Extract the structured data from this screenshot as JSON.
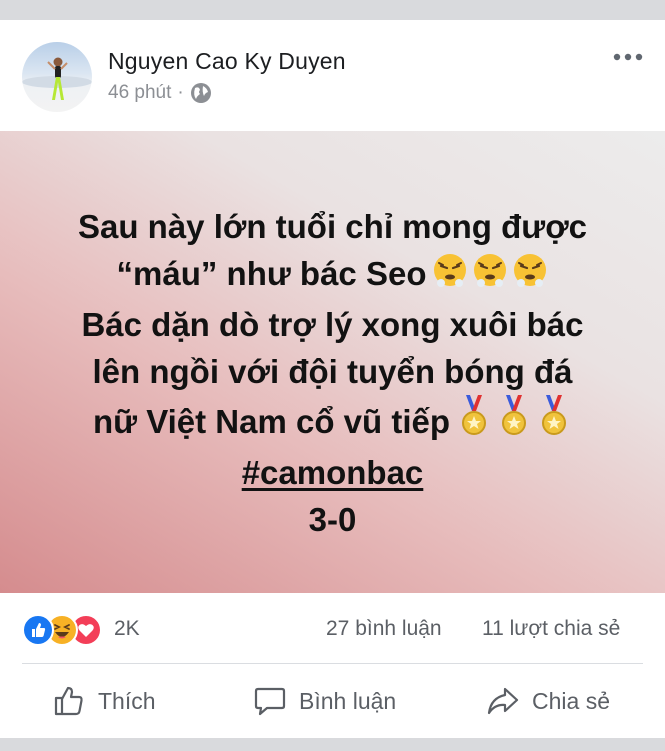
{
  "post": {
    "author": "Nguyen Cao Ky Duyen",
    "time": "46 phút",
    "separator": "·",
    "lines": [
      "Sau này lớn tuổi chỉ mong được",
      "“máu” như bác Seo",
      "Bác dặn dò trợ lý xong xuôi bác",
      "lên ngồi với đội tuyển bóng đá",
      "nữ Việt Nam cổ vũ tiếp",
      "#camonbac",
      "3-0"
    ],
    "emoji_line2": "huffing-face-emoji",
    "emoji_line5": "medal-emoji",
    "background_colors": [
      "#d58c8e",
      "#ececec"
    ]
  },
  "stats": {
    "reaction_icons": [
      "like-icon",
      "haha-icon",
      "love-icon"
    ],
    "reaction_count": "2K",
    "comments": "27 bình luận",
    "shares": "11 lượt chia sẻ"
  },
  "actions": {
    "like": "Thích",
    "comment": "Bình luận",
    "share": "Chia sẻ"
  },
  "colors": {
    "like_blue": "#1877f2",
    "love_red": "#f33e58",
    "haha_yellow": "#f7b125"
  }
}
